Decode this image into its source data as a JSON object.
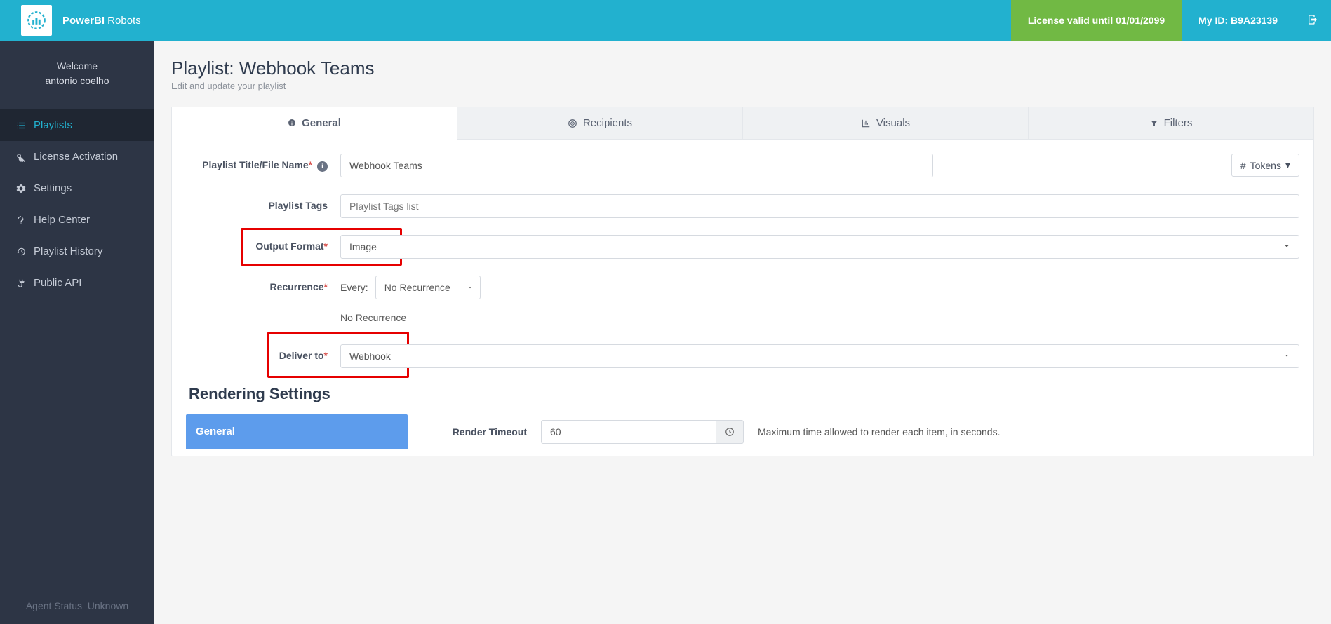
{
  "topbar": {
    "brand_bold": "PowerBI",
    "brand_light": " Robots",
    "license_label": "License valid until 01/01/2099",
    "my_id_label": "My ID: B9A23139"
  },
  "sidebar": {
    "welcome_line1": "Welcome",
    "welcome_line2": "antonio coelho",
    "items": [
      {
        "label": "Playlists"
      },
      {
        "label": "License Activation"
      },
      {
        "label": "Settings"
      },
      {
        "label": "Help Center"
      },
      {
        "label": "Playlist History"
      },
      {
        "label": "Public API"
      }
    ],
    "agent_status_label": "Agent Status",
    "agent_status_value": "Unknown"
  },
  "page": {
    "title": "Playlist: Webhook Teams",
    "subtitle": "Edit and update your playlist"
  },
  "tabs": {
    "general": "General",
    "recipients": "Recipients",
    "visuals": "Visuals",
    "filters": "Filters"
  },
  "form": {
    "title_label": "Playlist Title/File Name",
    "title_value": "Webhook Teams",
    "tokens_button": "Tokens",
    "tags_label": "Playlist Tags",
    "tags_placeholder": "Playlist Tags list",
    "output_format_label": "Output Format",
    "output_format_value": "Image",
    "recurrence_label": "Recurrence",
    "every_label": "Every:",
    "recurrence_value": "No Recurrence",
    "recurrence_text": "No Recurrence",
    "deliver_to_label": "Deliver to",
    "deliver_to_value": "Webhook"
  },
  "rendering": {
    "section_title": "Rendering Settings",
    "side_tab": "General",
    "timeout_label": "Render Timeout",
    "timeout_value": "60",
    "timeout_help": "Maximum time allowed to render each item, in seconds."
  }
}
